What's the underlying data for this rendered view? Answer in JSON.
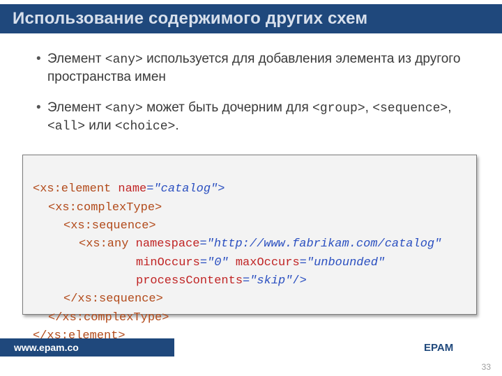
{
  "title": "Использование содержимого других схем",
  "bullets": [
    {
      "pre": "Элемент ",
      "code1": "<any>",
      "mid": " используется для добавления элемента из другого пространства имен",
      "tail": ""
    },
    {
      "pre": "Элемент ",
      "code1": "<any>",
      "mid": " может быть дочерним для ",
      "code2": "<group>",
      "mid2": ", ",
      "code3": "<sequence>",
      "mid3": ", ",
      "code4": "<all>",
      "mid4": " или ",
      "code5": "<choice>",
      "tail": "."
    }
  ],
  "code": {
    "l1": {
      "open": "<xs:element",
      "attr1": " name",
      "eq1": "=",
      "val1": "\"catalog\"",
      "close": ">"
    },
    "l2": "<xs:complexType>",
    "l3": "<xs:sequence>",
    "l4a": {
      "open": "<xs:any",
      "attr1": " namespace",
      "eq1": "=",
      "val1": "\"http://www.fabrikam.com/catalog\""
    },
    "l4b": {
      "attr1": "minOccurs",
      "eq1": "=",
      "val1": "\"0\"",
      "sp": " ",
      "attr2": "maxOccurs",
      "eq2": "=",
      "val2": "\"unbounded\""
    },
    "l4c": {
      "attr1": "processContents",
      "eq1": "=",
      "val1": "\"skip\"",
      "close": "/>"
    },
    "l5": "</xs:sequence>",
    "l6": "</xs:complexType>",
    "l7": "</xs:element>"
  },
  "footer": {
    "left": "www.epam.co",
    "right": "EPAM"
  },
  "page": "33"
}
